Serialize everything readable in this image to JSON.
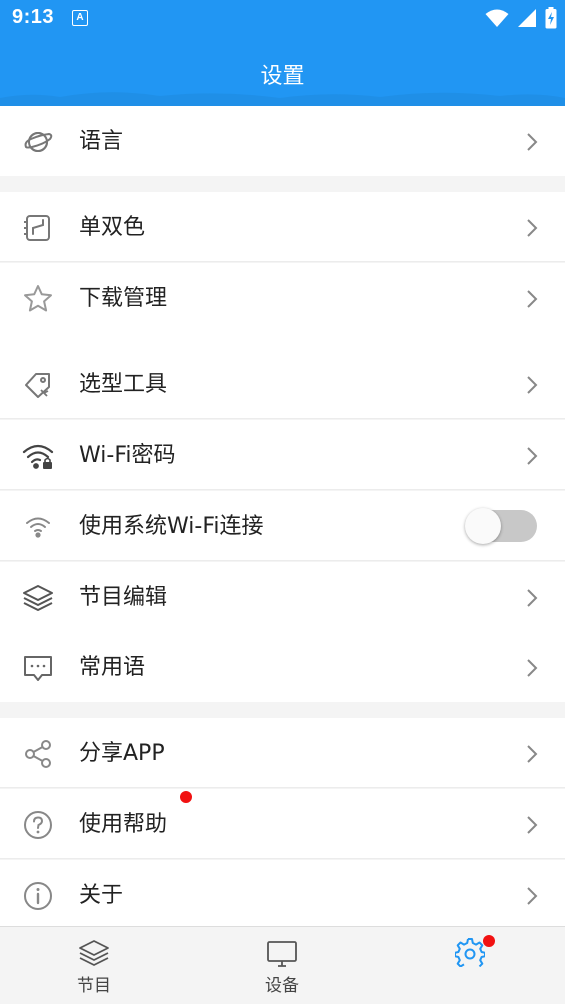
{
  "status_bar": {
    "time": "9:13",
    "notification_icon": "A",
    "icons": [
      "wifi-icon",
      "signal-icon",
      "battery-charging-icon"
    ]
  },
  "header": {
    "title": "设置"
  },
  "settings": [
    {
      "label": "语言",
      "icon": "planet-icon",
      "control": "chevron"
    },
    {
      "label": "单双色",
      "icon": "color-mode-icon",
      "control": "chevron"
    },
    {
      "label": "下载管理",
      "icon": "star-icon",
      "control": "chevron"
    },
    {
      "label": "选型工具",
      "icon": "tag-icon",
      "control": "chevron"
    },
    {
      "label": "Wi-Fi密码",
      "icon": "wifi-lock-icon",
      "control": "chevron"
    },
    {
      "label": "使用系统Wi-Fi连接",
      "icon": "wifi-icon",
      "control": "toggle",
      "toggle_on": false
    },
    {
      "label": "节目编辑",
      "icon": "layers-icon",
      "control": "chevron"
    },
    {
      "label": "常用语",
      "icon": "message-icon",
      "control": "chevron"
    },
    {
      "label": "分享APP",
      "icon": "share-icon",
      "control": "chevron"
    },
    {
      "label": "使用帮助",
      "icon": "help-icon",
      "control": "chevron",
      "badge": true
    },
    {
      "label": "关于",
      "icon": "info-icon",
      "control": "chevron"
    }
  ],
  "tabs": [
    {
      "label": "节目",
      "icon": "layers-icon",
      "active": false
    },
    {
      "label": "设备",
      "icon": "monitor-icon",
      "active": false
    },
    {
      "label": "",
      "icon": "settings-gear-icon",
      "active": true,
      "badge": true
    }
  ],
  "colors": {
    "primary": "#2196f3",
    "badge": "#f11111",
    "background": "#f4f4f4",
    "toggle_track_off": "#c8c8c8"
  }
}
